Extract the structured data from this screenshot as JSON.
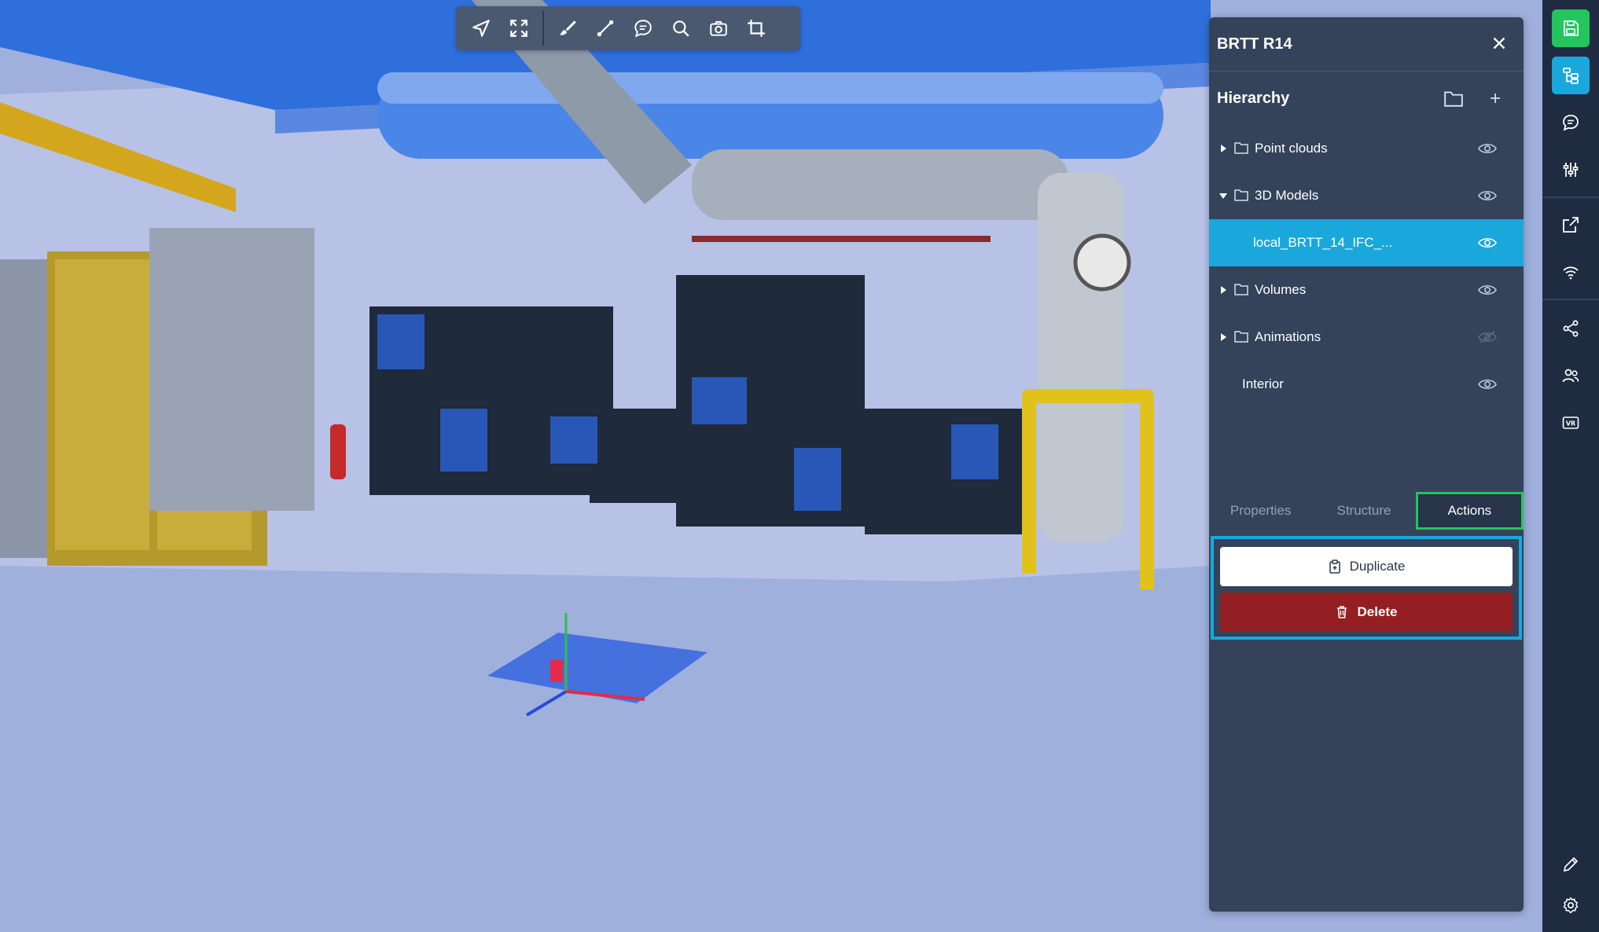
{
  "toolbar": {
    "icons": [
      "navigate-icon",
      "fullscreen-icon",
      "brush-icon",
      "measure-icon",
      "comment-icon",
      "search-icon",
      "camera-icon",
      "crop-icon"
    ]
  },
  "panel": {
    "title": "BRTT R14",
    "hierarchy_title": "Hierarchy",
    "tree": [
      {
        "label": "Point clouds",
        "expanded": false,
        "visible": true
      },
      {
        "label": "3D Models",
        "expanded": true,
        "visible": true
      },
      {
        "label": "local_BRTT_14_IFC_...",
        "selected": true,
        "visible": true
      },
      {
        "label": "Volumes",
        "expanded": false,
        "visible": true
      },
      {
        "label": "Animations",
        "expanded": false,
        "visible": false
      },
      {
        "label": "Interior",
        "visible": true
      }
    ],
    "tabs": [
      "Properties",
      "Structure",
      "Actions"
    ],
    "active_tab": "Actions",
    "actions": {
      "duplicate_label": "Duplicate",
      "delete_label": "Delete"
    }
  },
  "rail": {
    "icons": [
      "save-icon",
      "hierarchy-icon",
      "comments-icon",
      "sliders-icon",
      "external-link-icon",
      "wifi-icon",
      "share-icon",
      "users-icon",
      "vr-icon",
      "pen-icon",
      "settings-icon"
    ]
  },
  "colors": {
    "accent": "#1aa7dc",
    "save_green": "#22c55e",
    "delete_red": "#941f22",
    "panel_bg": "#34435a",
    "rail_bg": "#1e2b41"
  }
}
